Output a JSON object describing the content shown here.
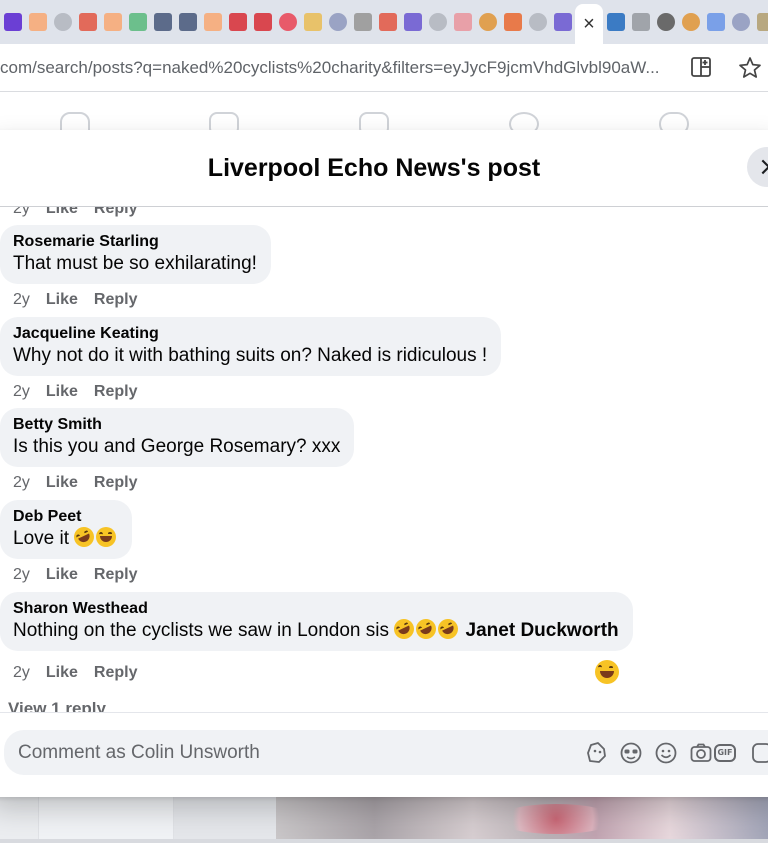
{
  "browser": {
    "url_domain": "com",
    "url_path": "/search/posts?q=naked%20cyclists%20charity&filters=eyJycF9jcmVhdGlvbl90aW...",
    "tab_close": "×"
  },
  "modal": {
    "title": "Liverpool Echo News's post",
    "close": "×"
  },
  "partial_action": {
    "age": "2y",
    "like": "Like",
    "reply": "Reply"
  },
  "comments": [
    {
      "author": "Rosemarie Starling",
      "text": "That must be so exhilarating!",
      "age": "2y",
      "like": "Like",
      "reply": "Reply"
    },
    {
      "author": "Jacqueline Keating",
      "text": "Why not do it with bathing suits on? Naked is ridiculous !",
      "age": "2y",
      "like": "Like",
      "reply": "Reply"
    },
    {
      "author": "Betty Smith",
      "text": "Is this you and George Rosemary? xxx",
      "age": "2y",
      "like": "Like",
      "reply": "Reply"
    },
    {
      "author": "Deb Peet",
      "text": "Love it",
      "age": "2y",
      "like": "Like",
      "reply": "Reply"
    },
    {
      "author": "Sharon Westhead",
      "text": "Nothing on the cyclists we saw in London sis",
      "mention": "Janet Duckworth",
      "age": "2y",
      "like": "Like",
      "reply": "Reply"
    }
  ],
  "view_reply": "View 1 reply",
  "comment_box": {
    "placeholder": "Comment as Colin Unsworth",
    "gif": "GIF"
  }
}
